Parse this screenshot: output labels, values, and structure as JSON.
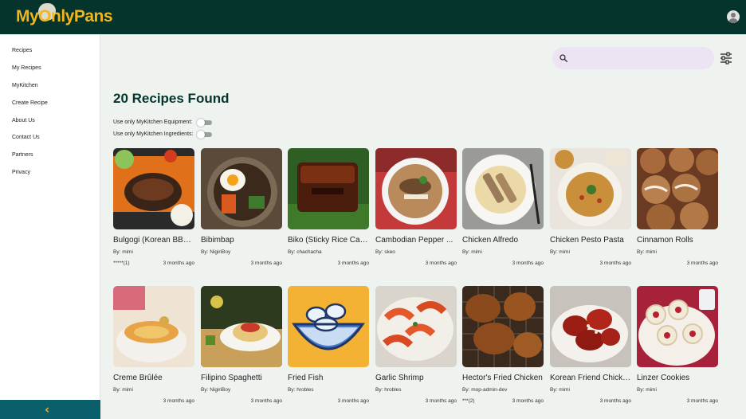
{
  "header": {
    "logo_text": "MyOnlyPans",
    "avatar_icon": "account-circle-icon",
    "brand_color": "#04342b",
    "accent_color": "#f2b51d"
  },
  "sidebar": {
    "items": [
      {
        "label": "Recipes"
      },
      {
        "label": "My Recipes"
      },
      {
        "label": "MyKitchen"
      },
      {
        "label": "Create Recipe"
      },
      {
        "label": "About Us"
      },
      {
        "label": "Contact Us"
      },
      {
        "label": "Partners"
      },
      {
        "label": "Privacy"
      }
    ],
    "collapse_icon": "chevron-left-icon",
    "collapse_glyph": "‹"
  },
  "search": {
    "placeholder": "",
    "value": "",
    "icon": "search-icon",
    "filter_icon": "filter-sliders-icon"
  },
  "main": {
    "title": "20 Recipes Found",
    "toggles": [
      {
        "label": "Use only MyKitchen Equipment:",
        "on": false
      },
      {
        "label": "Use only MyKitchen Ingredients:",
        "on": false
      }
    ],
    "recipes": [
      {
        "name": "Bulgogi (Korean BBQ...",
        "author": "By: mimi",
        "rating": "*****(1)",
        "time": "3 months ago"
      },
      {
        "name": "Bibimbap",
        "author": "By: NigiriBoy",
        "rating": "",
        "time": "3 months ago"
      },
      {
        "name": "Biko (Sticky Rice Cake)",
        "author": "By: chachacha",
        "rating": "",
        "time": "3 months ago"
      },
      {
        "name": "Cambodian Pepper ...",
        "author": "By: skeo",
        "rating": "",
        "time": "3 months ago"
      },
      {
        "name": "Chicken Alfredo",
        "author": "By: mimi",
        "rating": "",
        "time": "3 months ago"
      },
      {
        "name": "Chicken Pesto Pasta",
        "author": "By: mimi",
        "rating": "",
        "time": "3 months ago"
      },
      {
        "name": "Cinnamon Rolls",
        "author": "By: mimi",
        "rating": "",
        "time": "3 months ago"
      },
      {
        "name": "Creme Brûlée",
        "author": "By: mimi",
        "rating": "",
        "time": "3 months ago"
      },
      {
        "name": "Filipino Spaghetti",
        "author": "By: NigiriBoy",
        "rating": "",
        "time": "3 months ago"
      },
      {
        "name": "Fried Fish",
        "author": "By: hrobles",
        "rating": "",
        "time": "3 months ago"
      },
      {
        "name": "Garlic Shrimp",
        "author": "By: hrobles",
        "rating": "",
        "time": "3 months ago"
      },
      {
        "name": "Hector's Fried Chicken",
        "author": "By: mop-admin-dev",
        "rating": "***(2)",
        "time": "3 months ago"
      },
      {
        "name": "Korean Friend Chicken",
        "author": "By: mimi",
        "rating": "",
        "time": "3 months ago"
      },
      {
        "name": "Linzer Cookies",
        "author": "By: mimi",
        "rating": "",
        "time": "3 months ago"
      }
    ]
  }
}
